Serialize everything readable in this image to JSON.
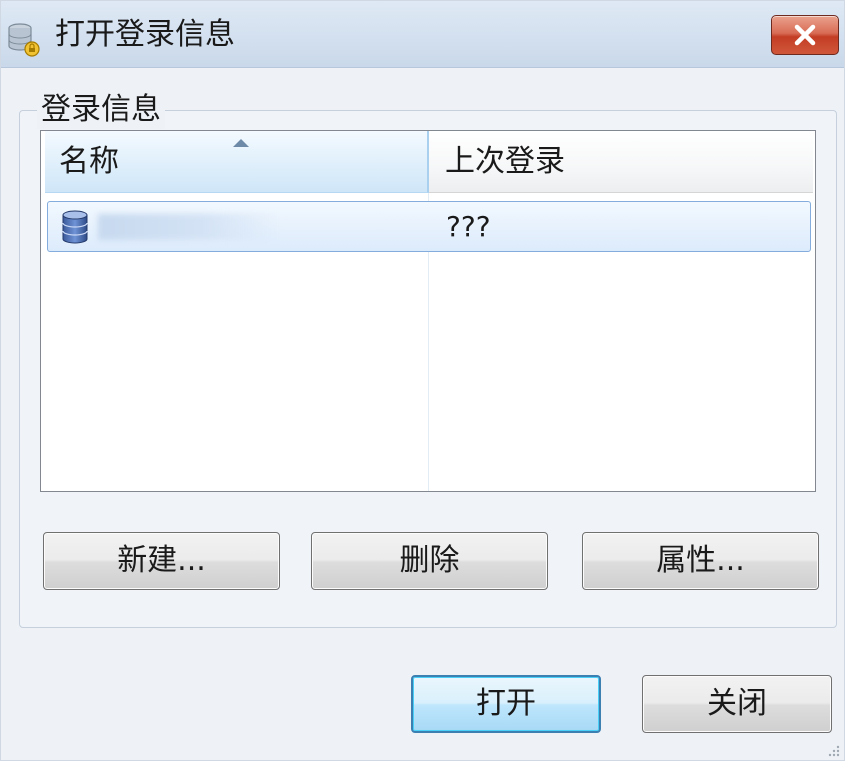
{
  "window": {
    "title": "打开登录信息",
    "icons": {
      "app": "database-login-icon",
      "close": "close-icon"
    }
  },
  "group": {
    "label": "登录信息"
  },
  "list": {
    "columns": [
      {
        "label": "名称",
        "sorted": "ascending"
      },
      {
        "label": "上次登录"
      }
    ],
    "rows": [
      {
        "icon": "database-icon",
        "name": "",
        "last_login": "???",
        "selected": true
      }
    ]
  },
  "actions": {
    "new_label": "新建...",
    "delete_label": "删除",
    "properties_label": "属性..."
  },
  "footer": {
    "open_label": "打开",
    "close_label": "关闭"
  },
  "colors": {
    "selection": "#dcebfc",
    "selection_border": "#84acdd",
    "default_button_border": "#3c7fb1",
    "close_button": "#c33d24"
  }
}
